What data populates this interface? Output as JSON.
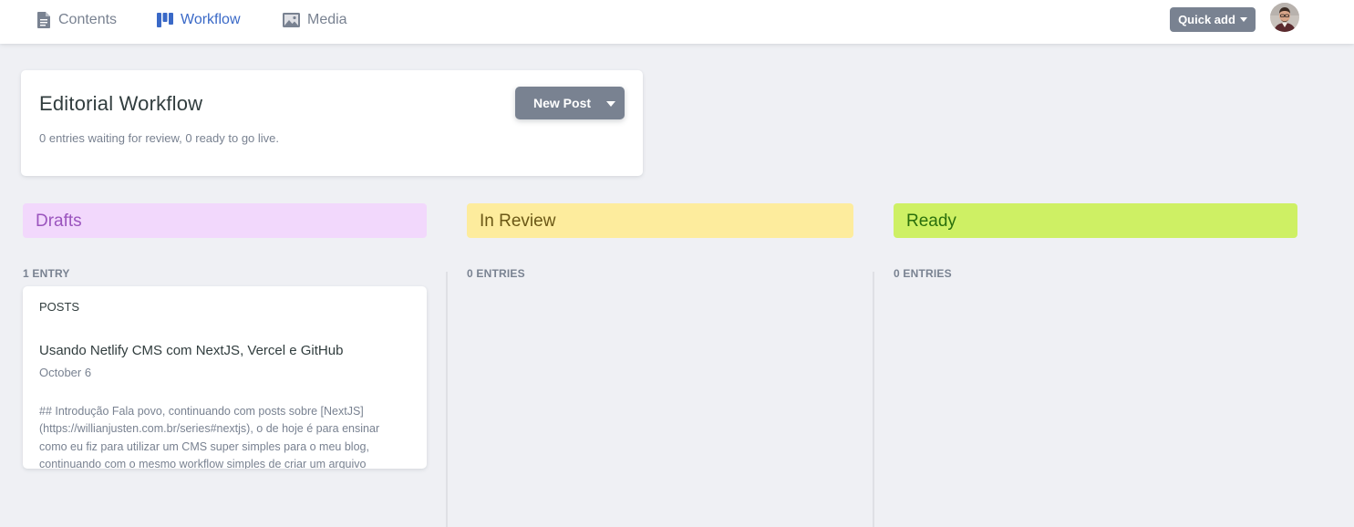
{
  "nav": {
    "items": [
      {
        "label": "Contents",
        "icon": "document-icon"
      },
      {
        "label": "Workflow",
        "icon": "workflow-icon",
        "active": true
      },
      {
        "label": "Media",
        "icon": "image-icon"
      }
    ],
    "quick_add_label": "Quick add"
  },
  "workflow": {
    "title": "Editorial Workflow",
    "subtitle": "0 entries waiting for review, 0 ready to go live.",
    "new_post_label": "New Post"
  },
  "columns": [
    {
      "label": "Drafts",
      "count": "1 ENTRY",
      "color": "#f2d8fc",
      "text_color": "#9b55be"
    },
    {
      "label": "In Review",
      "count": "0 ENTRIES",
      "color": "#fdec9d",
      "text_color": "#6b5816"
    },
    {
      "label": "Ready",
      "count": "0 ENTRIES",
      "color": "#cef064",
      "text_color": "#2a6f0c"
    }
  ],
  "entries": [
    {
      "collection": "POSTS",
      "title": "Usando Netlify CMS com NextJS, Vercel e GitHub",
      "date": "October 6",
      "body": "## Introdução Fala povo, continuando com posts sobre [NextJS] (https://willianjusten.com.br/series#nextjs), o de hoje é para ensinar como eu fiz para utilizar um CMS super simples para o meu blog, continuando com o mesmo workflow simples de criar um arquivo"
    }
  ],
  "colors": {
    "accent": "#3a69c7",
    "muted": "#798291",
    "background": "#eff0f4"
  }
}
